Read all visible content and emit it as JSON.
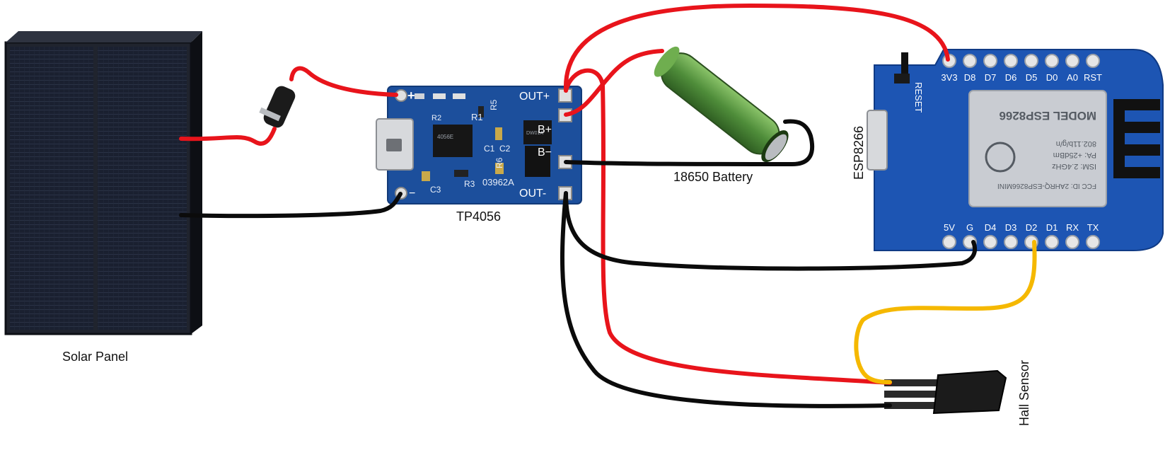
{
  "labels": {
    "solar_panel": "Solar Panel",
    "tp4056": "TP4056",
    "battery": "18650 Battery",
    "esp8266": "ESP8266",
    "hall_sensor": "Hall Sensor"
  },
  "tp4056_board": {
    "pins": {
      "in_plus": "+",
      "in_minus": "−",
      "out_plus": "OUT+",
      "b_plus": "B+",
      "b_minus": "B−",
      "out_minus": "OUT-"
    },
    "silk": {
      "r2": "R2",
      "r1": "R1",
      "r3": "R3",
      "r5": "R5",
      "r6": "R6",
      "c1": "C1",
      "c2": "C2",
      "c3": "C3",
      "code": "03962A",
      "chip": "4056E",
      "chip2": "DW01A"
    }
  },
  "esp_board": {
    "top_pins": [
      "3V3",
      "D8",
      "D7",
      "D6",
      "D5",
      "D0",
      "A0",
      "RST"
    ],
    "bottom_pins": [
      "5V",
      "G",
      "D4",
      "D3",
      "D2",
      "D1",
      "RX",
      "TX"
    ],
    "reset_label": "RESET",
    "module_text": [
      "FCC ID: 2AHRQ-ESP8266MINI",
      "ISM: 2.4GHz",
      "PA: +25dBm",
      "802.11b/g/n",
      "MODEL ESP8266"
    ]
  },
  "wire_colors": {
    "power": "#e8141b",
    "ground": "#0b0b0b",
    "signal": "#f5b800"
  }
}
